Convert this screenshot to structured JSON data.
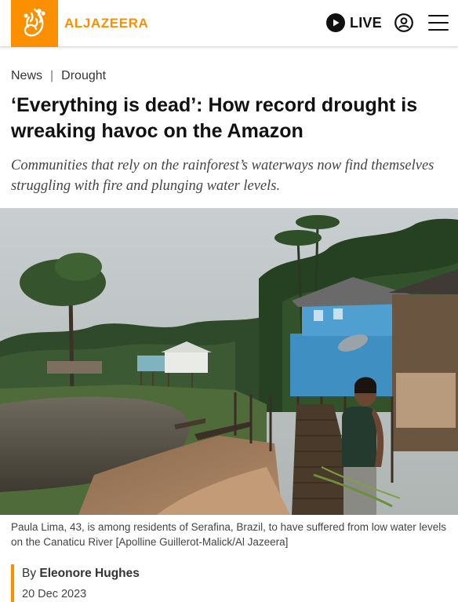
{
  "header": {
    "brand": "ALJAZEERA",
    "live_label": "LIVE",
    "brand_color": "#fa9000",
    "icons": {
      "logo": "aljazeera-logo-icon",
      "play": "play-icon",
      "account": "user-account-icon",
      "menu": "hamburger-menu-icon"
    }
  },
  "breadcrumb": {
    "items": [
      "News",
      "Drought"
    ],
    "separator": "|"
  },
  "article": {
    "title": "‘Everything is dead’: How record drought is wreaking havoc on the Amazon",
    "subtitle": "Communities that rely on the rainforest’s waterways now find themselves struggling with fire and plunging water levels.",
    "image_caption": "Paula Lima, 43, is among residents of Serafina, Brazil, to have suffered from low water levels on the Canaticu River [Apolline Guillerot-Malick/Al Jazeera]",
    "byline_prefix": "By",
    "author": "Eleonore Hughes",
    "date": "20 Dec 2023"
  }
}
